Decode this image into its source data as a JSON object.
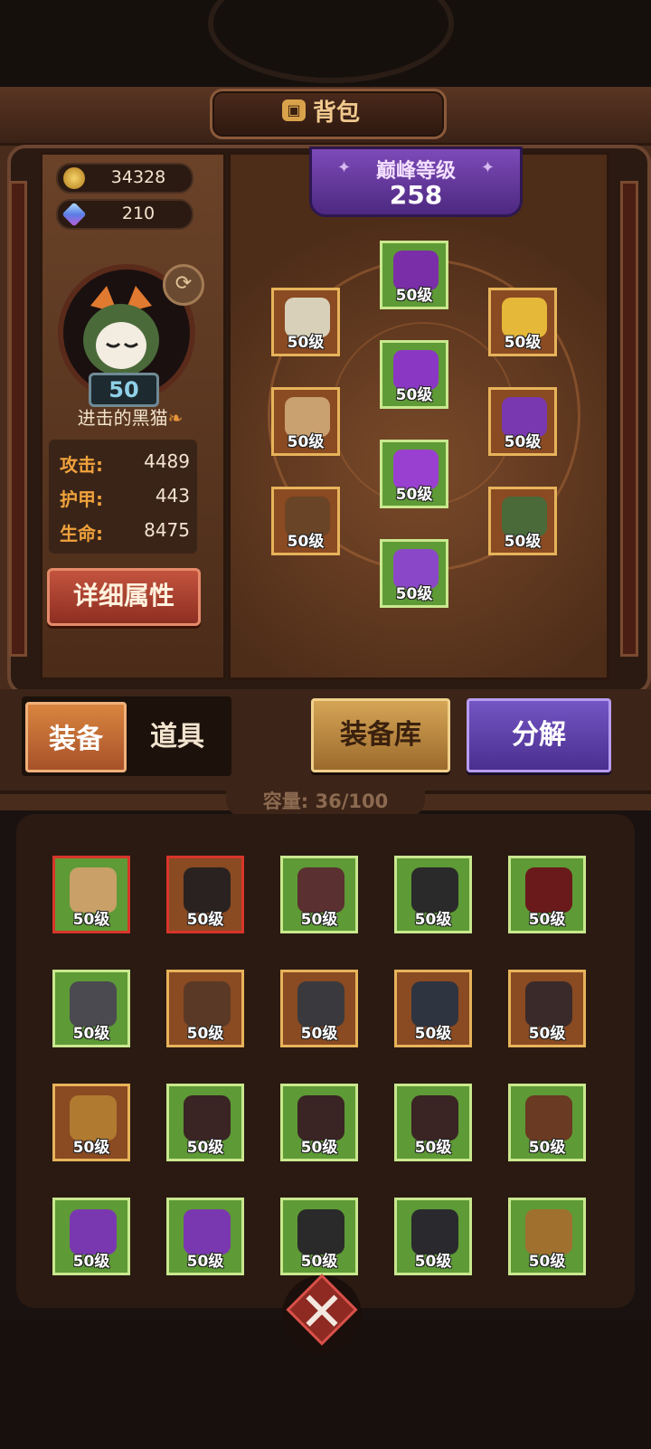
{
  "title": {
    "icon": "backpack-icon",
    "text": "背包"
  },
  "currency": [
    {
      "icon": "gold-coin-icon",
      "value": "34328",
      "color": "#e0a93a"
    },
    {
      "icon": "gem-icon",
      "value": "210",
      "color": "#8ec7f0"
    }
  ],
  "player": {
    "level": "50",
    "name": "进击的黑猫",
    "stats": [
      {
        "label": "攻击:",
        "value": "4489"
      },
      {
        "label": "护甲:",
        "value": "443"
      },
      {
        "label": "生命:",
        "value": "8475"
      }
    ],
    "detail_button": "详细属性"
  },
  "peak": {
    "label": "巅峰等级",
    "value": "258"
  },
  "equipped": [
    {
      "name": "helmet-slot",
      "level": "50级",
      "rarity": "orange",
      "color": "#d8d0b8"
    },
    {
      "name": "head-slot",
      "level": "50级",
      "rarity": "green",
      "color": "#7a2ea8"
    },
    {
      "name": "amulet-slot",
      "level": "50级",
      "rarity": "orange",
      "color": "#e6b83a"
    },
    {
      "name": "gauntlet-slot",
      "level": "50级",
      "rarity": "orange",
      "color": "#c9a070"
    },
    {
      "name": "chest-slot",
      "level": "50级",
      "rarity": "green",
      "color": "#8a38c4"
    },
    {
      "name": "ring-slot",
      "level": "50级",
      "rarity": "orange",
      "color": "#7a38b0"
    },
    {
      "name": "weapon-slot",
      "level": "50级",
      "rarity": "orange",
      "color": "#6a4426"
    },
    {
      "name": "pants-slot",
      "level": "50级",
      "rarity": "green",
      "color": "#9a40d0"
    },
    {
      "name": "quiver-slot",
      "level": "50级",
      "rarity": "orange",
      "color": "#4a6a3a"
    },
    {
      "name": "boots-slot",
      "level": "50级",
      "rarity": "green",
      "color": "#8a48c8"
    }
  ],
  "tabs": {
    "equipment": "装备",
    "items": "道具"
  },
  "buttons": {
    "vault": "装备库",
    "decompose": "分解"
  },
  "capacity": "容量: 36/100",
  "inventory": [
    {
      "level": "50级",
      "rarity": "green",
      "red": true,
      "color": "#c8a068"
    },
    {
      "level": "50级",
      "rarity": "orange",
      "red": true,
      "color": "#2a2220"
    },
    {
      "level": "50级",
      "rarity": "green",
      "red": false,
      "color": "#5a3030"
    },
    {
      "level": "50级",
      "rarity": "green",
      "red": false,
      "color": "#2a2a2a"
    },
    {
      "level": "50级",
      "rarity": "green",
      "red": false,
      "color": "#6a1a1a"
    },
    {
      "level": "50级",
      "rarity": "green",
      "red": false,
      "color": "#4a4a50"
    },
    {
      "level": "50级",
      "rarity": "orange",
      "red": false,
      "color": "#5a3a26"
    },
    {
      "level": "50级",
      "rarity": "orange",
      "red": false,
      "color": "#3a3a3e"
    },
    {
      "level": "50级",
      "rarity": "orange",
      "red": false,
      "color": "#2e3440"
    },
    {
      "level": "50级",
      "rarity": "orange",
      "red": false,
      "color": "#3a2a2a"
    },
    {
      "level": "50级",
      "rarity": "orange",
      "red": false,
      "color": "#b07a30"
    },
    {
      "level": "50级",
      "rarity": "green",
      "red": false,
      "color": "#3a2424"
    },
    {
      "level": "50级",
      "rarity": "green",
      "red": false,
      "color": "#3a2424"
    },
    {
      "level": "50级",
      "rarity": "green",
      "red": false,
      "color": "#3a2424"
    },
    {
      "level": "50级",
      "rarity": "green",
      "red": false,
      "color": "#6a3a22"
    },
    {
      "level": "50级",
      "rarity": "green",
      "red": false,
      "color": "#7a38b0"
    },
    {
      "level": "50级",
      "rarity": "green",
      "red": false,
      "color": "#7a38b0"
    },
    {
      "level": "50级",
      "rarity": "green",
      "red": false,
      "color": "#2a2a2a"
    },
    {
      "level": "50级",
      "rarity": "green",
      "red": false,
      "color": "#2a2a2e"
    },
    {
      "level": "50级",
      "rarity": "green",
      "red": false,
      "color": "#a0702e"
    }
  ],
  "close_icon": "close-icon"
}
